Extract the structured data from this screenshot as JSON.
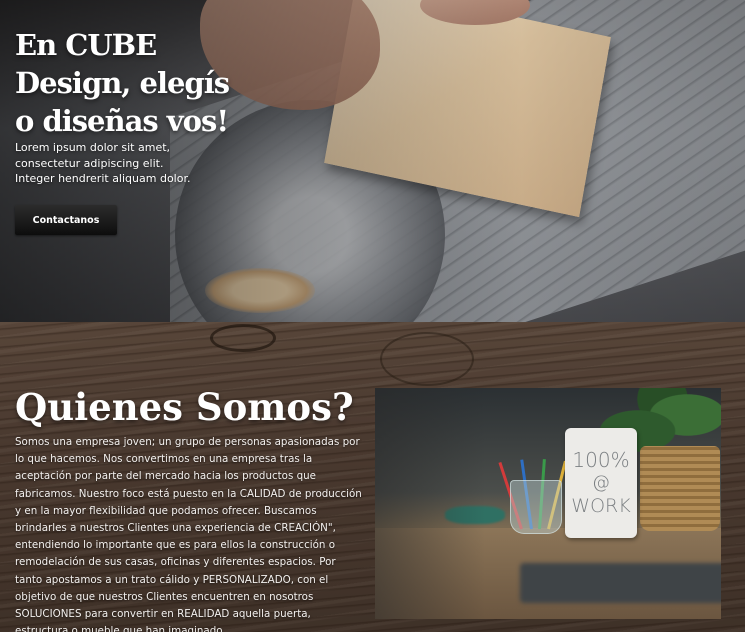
{
  "hero": {
    "title": "En CUBE Design, elegís o diseñas vos!",
    "text": "Lorem ipsum dolor sit amet, consectetur adipiscing elit. Integer hendrerit aliquam dolor.",
    "cta_label": "Contactanos"
  },
  "about": {
    "title": "Quienes Somos?",
    "text": "Somos una empresa joven; un grupo de personas apasionadas por lo que hacemos. Nos convertimos en una empresa tras la aceptación por parte del mercado hacia los productos que fabricamos. Nuestro foco está puesto en la CALIDAD de producción y en la mayor flexibilidad que podamos ofrecer. Buscamos brindarles a nuestros Clientes una experiencia de CREACIÓN\", entendiendo lo importante que es para ellos la construcción o remodelación de sus casas, oficinas y diferentes espacios. Por tanto apostamos a un trato cálido y PERSONALIZADO, con el objetivo de que nuestros Clientes encuentren en nosotros SOLUCIONES para convertir en REALIDAD aquella puerta, estructura o mueble que han imaginado.",
    "sign_line1": "100%",
    "sign_line2": "@",
    "sign_line3": "WORK"
  }
}
